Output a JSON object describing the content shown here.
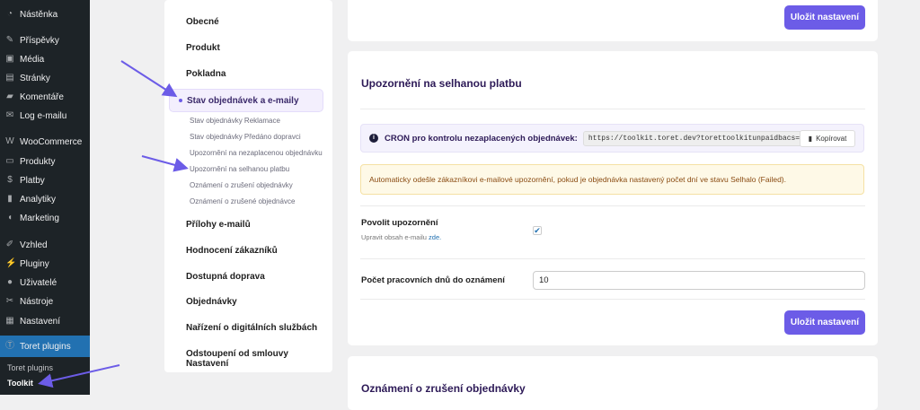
{
  "sidebar": {
    "items": [
      {
        "label": "Nástěnka",
        "icon": "dashboard-icon"
      },
      {
        "label": "Příspěvky",
        "icon": "pin-icon"
      },
      {
        "label": "Média",
        "icon": "media-icon"
      },
      {
        "label": "Stránky",
        "icon": "pages-icon"
      },
      {
        "label": "Komentáře",
        "icon": "comment-icon"
      },
      {
        "label": "Log e-mailu",
        "icon": "mail-icon"
      },
      {
        "label": "WooCommerce",
        "icon": "woo-icon"
      },
      {
        "label": "Produkty",
        "icon": "archive-icon"
      },
      {
        "label": "Platby",
        "icon": "dollar-icon"
      },
      {
        "label": "Analytiky",
        "icon": "chart-icon"
      },
      {
        "label": "Marketing",
        "icon": "megaphone-icon"
      },
      {
        "label": "Vzhled",
        "icon": "brush-icon"
      },
      {
        "label": "Pluginy",
        "icon": "plugin-icon"
      },
      {
        "label": "Uživatelé",
        "icon": "user-icon"
      },
      {
        "label": "Nástroje",
        "icon": "wrench-icon"
      },
      {
        "label": "Nastavení",
        "icon": "settings-icon"
      },
      {
        "label": "Toret plugins",
        "icon": "toret-icon"
      }
    ],
    "submenu": [
      "Toret plugins",
      "Toolkit"
    ]
  },
  "nav": {
    "items": [
      "Obecné",
      "Produkt",
      "Pokladna"
    ],
    "active": "Stav objednávek a e-maily",
    "subitems": [
      "Stav objednávky Reklamace",
      "Stav objednávky Předáno dopravci",
      "Upozornění na nezaplacenou objednávku",
      "Upozornění na selhanou platbu",
      "Oznámení o zrušení objednávky",
      "Oznámení o zrušené objednávce"
    ],
    "items_after": [
      "Přílohy e-mailů",
      "Hodnocení zákazníků",
      "Dostupná doprava",
      "Objednávky",
      "Nařízení o digitálních službách",
      "Odstoupení od smlouvy Nastavení"
    ]
  },
  "save_label": "Uložit nastavení",
  "section": {
    "title": "Upozornění na selhanou platbu",
    "cron_label": "CRON pro kontrolu nezaplacených objednávek:",
    "cron_url": "https://toolkit.toret.dev?torettoolkitunpaidbacs=check",
    "copy_label": "Kopírovat",
    "notice": "Automaticky odešle zákazníkovi e-mailové upozornění, pokud je objednávka nastavený počet dní ve stavu Selhalo (Failed).",
    "enable_label": "Povolit upozornění",
    "enable_hint": "Upravit obsah e-mailu",
    "enable_link": "zde.",
    "enabled": true,
    "days_label": "Počet pracovních dnů do oznámení",
    "days_value": "10"
  },
  "next_section": {
    "title": "Oznámení o zrušení objednávky"
  },
  "colors": {
    "accent": "#6c5ce7",
    "sidebar": "#1d2327",
    "active": "#2271b1"
  }
}
